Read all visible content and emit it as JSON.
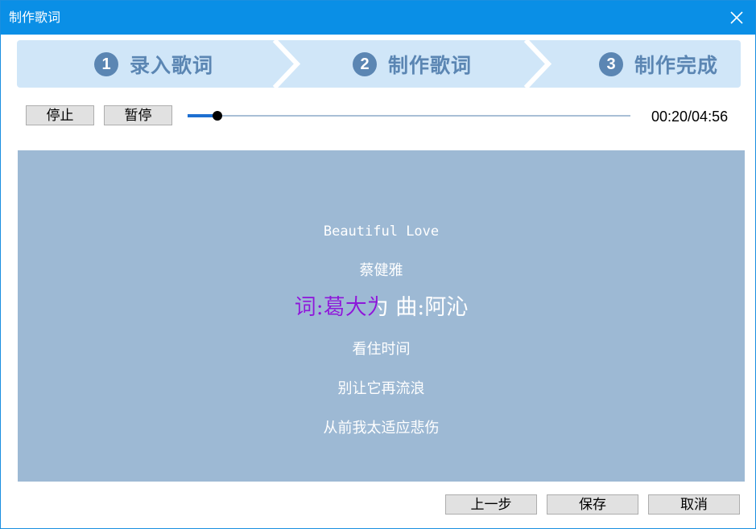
{
  "window": {
    "title": "制作歌词"
  },
  "steps": [
    {
      "num": "1",
      "label": "录入歌词"
    },
    {
      "num": "2",
      "label": "制作歌词"
    },
    {
      "num": "3",
      "label": "制作完成"
    }
  ],
  "controls": {
    "stop_label": "停止",
    "pause_label": "暂停",
    "time": "00:20/04:56",
    "progress": 0.0676
  },
  "lyrics": {
    "before": [
      "Beautiful Love",
      "蔡健雅"
    ],
    "current": "词:葛大为  曲:阿沁",
    "current_progress": 0.48,
    "after": [
      "看住时间",
      "别让它再流浪",
      "从前我太适应悲伤"
    ]
  },
  "footer": {
    "prev_label": "上一步",
    "save_label": "保存",
    "cancel_label": "取消"
  },
  "colors": {
    "titlebar": "#0a8fe6",
    "step_bg": "#d0e6f8",
    "step_fg": "#5b86b3",
    "lyrics_bg": "#9db9d4",
    "highlight": "#8a1ad8"
  }
}
